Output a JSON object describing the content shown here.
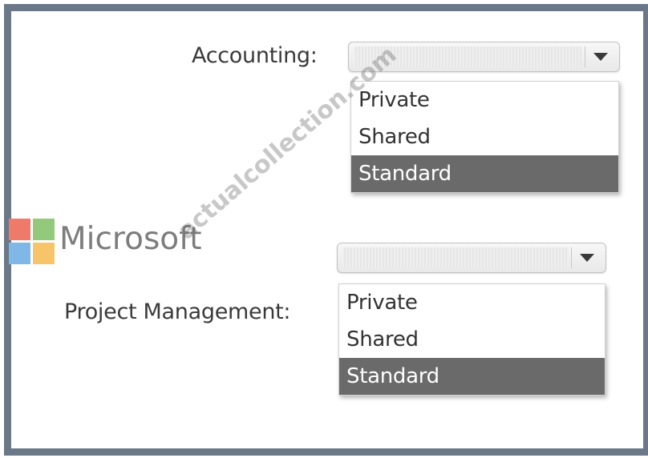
{
  "accounting": {
    "label": "Accounting:",
    "selected_value": "",
    "options": [
      {
        "label": "Private",
        "selected": false
      },
      {
        "label": "Shared",
        "selected": false
      },
      {
        "label": "Standard",
        "selected": true
      }
    ]
  },
  "project_management": {
    "label": "Project Management:",
    "selected_value": "",
    "options": [
      {
        "label": "Private",
        "selected": false
      },
      {
        "label": "Shared",
        "selected": false
      },
      {
        "label": "Standard",
        "selected": true
      }
    ]
  },
  "branding": {
    "name": "Microsoft",
    "logo_colors": [
      "#f25022",
      "#7fba00",
      "#00a4ef",
      "#ffb900"
    ],
    "watermark": "actualcollection.com"
  },
  "colors": {
    "frame_border": "#6b7888",
    "selected_option_bg": "#6a6a6a"
  }
}
